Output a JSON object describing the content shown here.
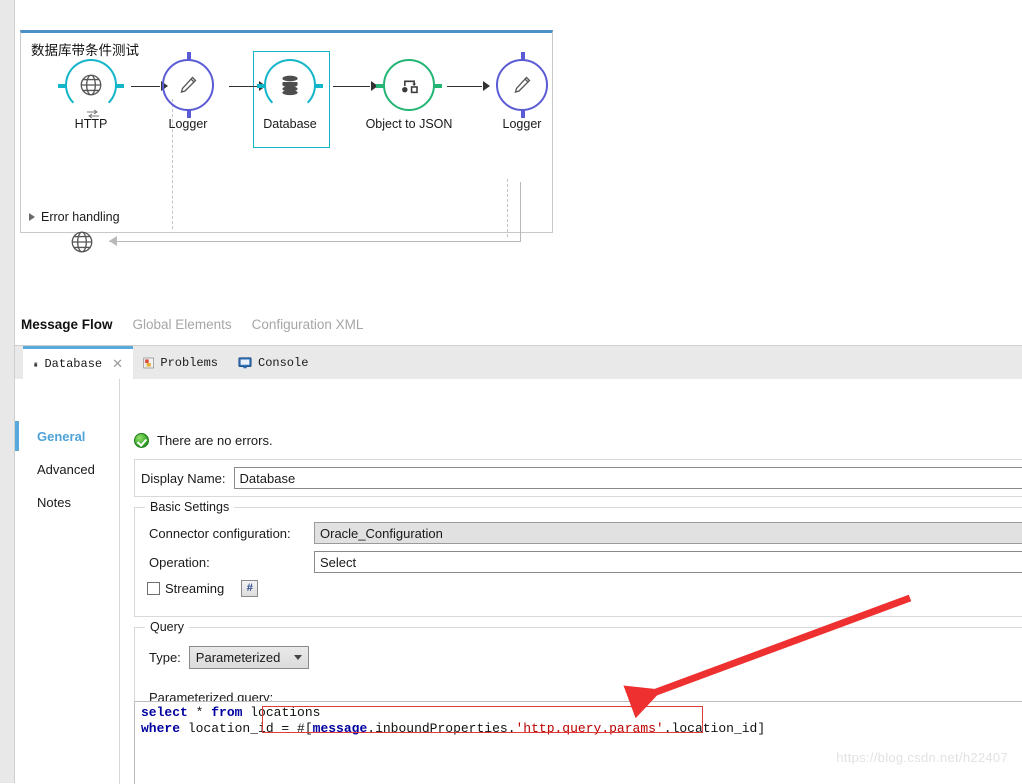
{
  "flow": {
    "title": "数据库带条件测试",
    "nodes": [
      {
        "label": "HTTP",
        "icon": "globe-icon",
        "type": "http"
      },
      {
        "label": "Logger",
        "icon": "pencil-icon",
        "type": "logger"
      },
      {
        "label": "Database",
        "icon": "database-icon",
        "type": "database",
        "selected": true
      },
      {
        "label": "Object to JSON",
        "icon": "transform-icon",
        "type": "json"
      },
      {
        "label": "Logger",
        "icon": "pencil-icon",
        "type": "logger"
      }
    ],
    "return_node_icon": "globe-icon",
    "error_handling_label": "Error handling",
    "colors": {
      "http": "#13b5c9",
      "logger": "#5b5bd6",
      "database": "#13b5c9",
      "json": "#22b573",
      "selection": "#13b5c9",
      "flow_top_border": "#4a90c4"
    }
  },
  "editor_tabs": [
    {
      "label": "Message Flow",
      "active": true
    },
    {
      "label": "Global Elements",
      "active": false
    },
    {
      "label": "Configuration XML",
      "active": false
    }
  ],
  "view_tabs": [
    {
      "label": "Database",
      "icon": "database-icon",
      "active": true,
      "closable": true
    },
    {
      "label": "Problems",
      "icon": "problems-icon",
      "active": false,
      "closable": false
    },
    {
      "label": "Console",
      "icon": "console-icon",
      "active": false,
      "closable": false
    }
  ],
  "sub_nav": [
    {
      "label": "General",
      "active": true
    },
    {
      "label": "Advanced",
      "active": false
    },
    {
      "label": "Notes",
      "active": false
    }
  ],
  "status": {
    "icon": "ok-check-icon",
    "text": "There are no errors."
  },
  "form": {
    "display_name_label": "Display Name:",
    "display_name_value": "Database",
    "basic_settings_legend": "Basic Settings",
    "connector_config_label": "Connector configuration:",
    "connector_config_value": "Oracle_Configuration",
    "operation_label": "Operation:",
    "operation_value": "Select",
    "streaming_label": "Streaming",
    "streaming_checked": false,
    "mel_button_label": "#",
    "query_legend": "Query",
    "type_label": "Type:",
    "type_value": "Parameterized",
    "parameterized_query_label": "Parameterized query:"
  },
  "code": {
    "line1": {
      "kw_select": "select",
      "star": " * ",
      "kw_from": "from",
      "table": " locations"
    },
    "line2": {
      "kw_where": "where",
      "column": " location_id = ",
      "expr_open": "#[",
      "expr_obj": "message",
      "expr_mid": ".inboundProperties.",
      "expr_str": "'http.query.params'",
      "expr_tail": ".location_id]"
    },
    "full_line1": "select * from locations",
    "full_line2": "where location_id = #[message.inboundProperties.'http.query.params'.location_id]"
  },
  "annotation": {
    "highlight_color": "#e03a3a",
    "arrow_color": "#ef3030"
  },
  "watermark": "https://blog.csdn.net/h22407"
}
